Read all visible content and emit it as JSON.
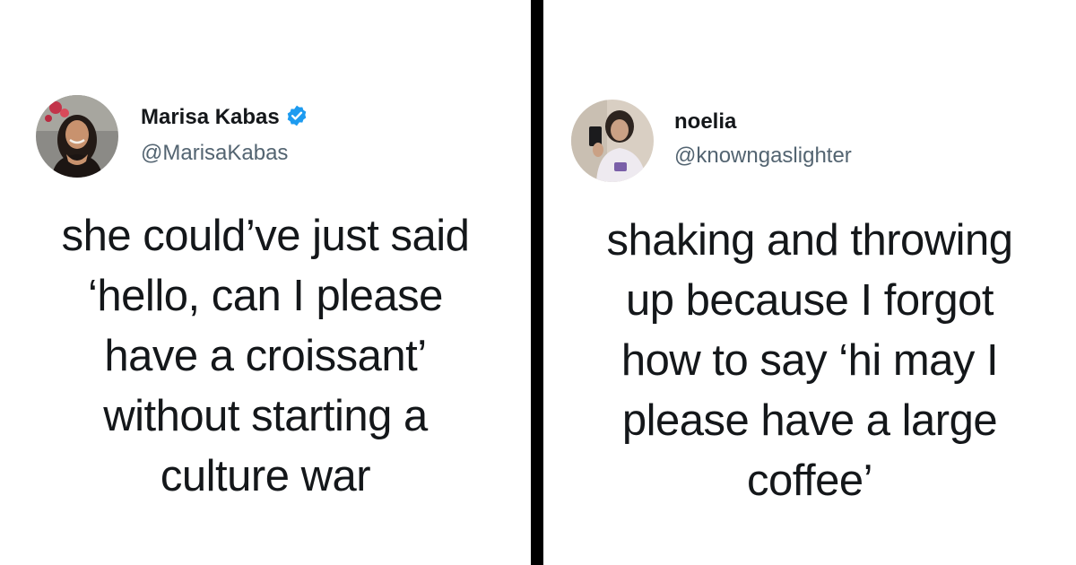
{
  "left_tweet": {
    "display_name": "Marisa Kabas",
    "handle": "@MarisaKabas",
    "verified": true,
    "verified_color": "#1d9bf0",
    "avatar_icon": "profile-photo-woman-dark-hair",
    "text_lines": [
      "she could’ve just said",
      "‘hello, can I please",
      "have a croissant’",
      "without starting a",
      "culture war"
    ]
  },
  "right_tweet": {
    "display_name": "noelia",
    "handle": "@knowngaslighter",
    "verified": false,
    "avatar_icon": "profile-photo-mirror-selfie",
    "text_lines": [
      "shaking and throwing",
      "up because I forgot",
      "how to say ‘hi may I",
      "please have a large",
      "coffee’"
    ]
  },
  "colors": {
    "divider": "#000000",
    "text": "#14171a",
    "handle": "#536471",
    "background": "#ffffff"
  }
}
